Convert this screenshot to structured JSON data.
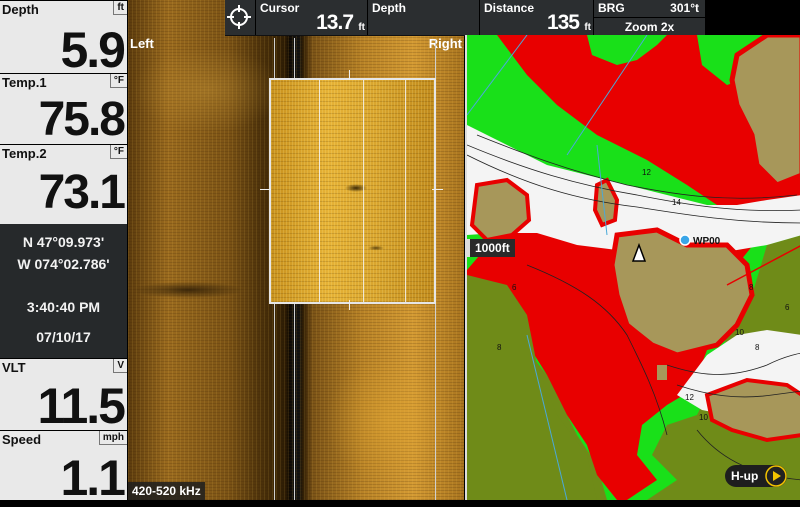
{
  "data_panel": {
    "depth": {
      "label": "Depth",
      "unit": "ft",
      "value": "5.9"
    },
    "temp1": {
      "label": "Temp.1",
      "unit": "°F",
      "value": "75.8"
    },
    "temp2": {
      "label": "Temp.2",
      "unit": "°F",
      "value": "73.1"
    },
    "position": {
      "lat": "N  47°09.973'",
      "lon": "W  074°02.786'"
    },
    "time": "3:40:40 PM",
    "date": "07/10/17",
    "voltage": {
      "label": "VLT",
      "unit": "V",
      "value": "11.5"
    },
    "speed": {
      "label": "Speed",
      "unit": "mph",
      "value": "1.1"
    }
  },
  "top_bar": {
    "cursor": {
      "label": "Cursor",
      "value": "13.7",
      "unit": "ft"
    },
    "depth": {
      "label": "Depth",
      "value": "",
      "unit": ""
    },
    "distance": {
      "label": "Distance",
      "value": "135",
      "unit": "ft"
    },
    "brg": {
      "label": "BRG",
      "value": "301°t"
    },
    "zoom": "Zoom 2x"
  },
  "sonar": {
    "left_label": "Left",
    "right_label": "Right",
    "frequency": "420-520 kHz"
  },
  "chart": {
    "scale": "1000ft",
    "waypoint_label": "WP00",
    "orientation": "H-up",
    "contour_labels": [
      "12",
      "14",
      "6",
      "8",
      "10",
      "8",
      "6",
      "12",
      "10",
      "6",
      "8"
    ]
  },
  "colors": {
    "land": "#a7975a",
    "shallow": "#e80000",
    "mid_depth": "#19e019",
    "deep": "#f4f4f4",
    "background_panel": "#26292b",
    "accent": "#f2c200"
  },
  "icons": {
    "cursor": "crosshair-icon",
    "boat": "boat-icon",
    "waypoint": "waypoint-icon",
    "menu": "play-arrow-icon"
  }
}
